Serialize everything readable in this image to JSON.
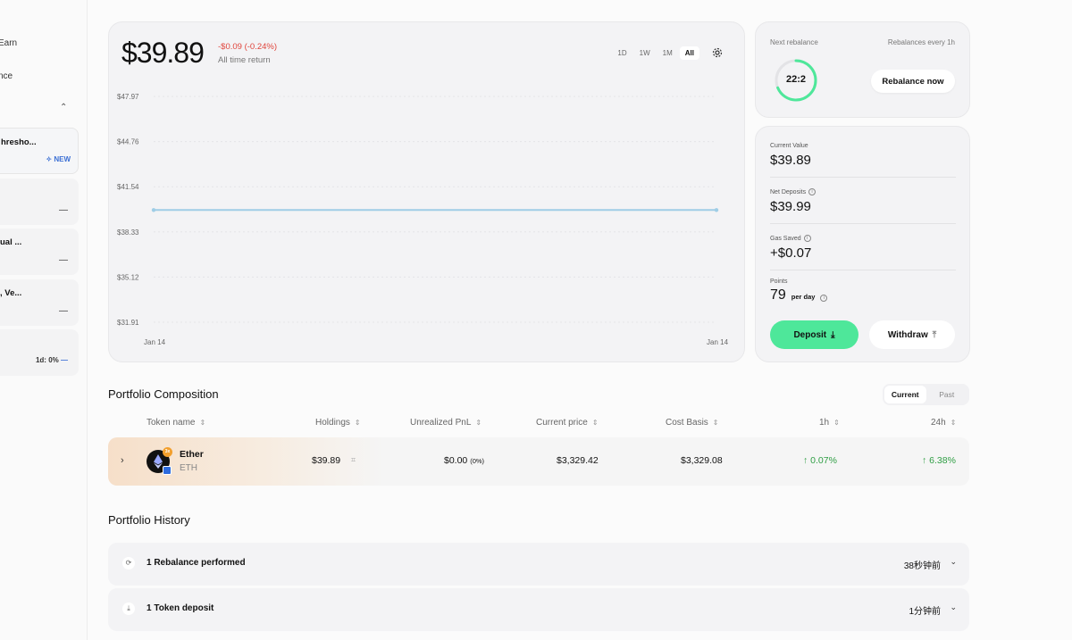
{
  "sidebar": {
    "earn_label": "Earn",
    "nce_label": "nce",
    "cards": [
      {
        "title": "hresho...",
        "badge": "NEW",
        "badge_icon": "sparkle-icon"
      },
      {
        "title": "",
        "value": "—"
      },
      {
        "title": "ual ...",
        "value": "—"
      },
      {
        "title": ", Ve...",
        "value": "—"
      },
      {
        "title": "",
        "value": "1d: 0%",
        "value_dash": "—"
      }
    ]
  },
  "chart": {
    "value": "$39.89",
    "delta": "-$0.09 (-0.24%)",
    "delta_label": "All time return",
    "ranges": [
      "1D",
      "1W",
      "1M",
      "All"
    ],
    "active_range": "All"
  },
  "chart_data": {
    "type": "line",
    "title": "",
    "x": [
      "Jan 14",
      "Jan 14"
    ],
    "y": [
      39.89,
      39.89
    ],
    "yticks": [
      "$47.97",
      "$44.76",
      "$41.54",
      "$38.33",
      "$35.12",
      "$31.91"
    ],
    "xticks": [
      "Jan 14",
      "Jan 14"
    ],
    "ylim": [
      31.91,
      47.97
    ],
    "color": "#9fcde6"
  },
  "rebalance": {
    "next_label": "Next rebalance",
    "every_label": "Rebalances every 1h",
    "timer": "22:2",
    "button": "Rebalance now",
    "progress_color": "#4ee79a"
  },
  "stats": {
    "current_value_label": "Current Value",
    "current_value": "$39.89",
    "net_deposits_label": "Net Deposits",
    "net_deposits": "$39.99",
    "gas_saved_label": "Gas Saved",
    "gas_saved": "+$0.07",
    "points_label": "Points",
    "points": "79",
    "points_unit": "per day",
    "deposit_button": "Deposit",
    "withdraw_button": "Withdraw",
    "deposit_color": "#4ee79a"
  },
  "composition": {
    "title": "Portfolio Composition",
    "toggle": [
      "Current",
      "Past"
    ],
    "active_toggle": "Current",
    "headers": {
      "token": "Token name",
      "holdings": "Holdings",
      "pnl": "Unrealized PnL",
      "price": "Current price",
      "cost": "Cost Basis",
      "h1": "1h",
      "h24": "24h"
    },
    "rows": [
      {
        "name": "Ether",
        "symbol": "ETH",
        "badge": "3x",
        "holdings": "$39.89",
        "pnl": "$0.00",
        "pnl_pct": "(0%)",
        "price": "$3,329.42",
        "cost": "$3,329.08",
        "h1": "0.07%",
        "h24": "6.38%"
      }
    ]
  },
  "history": {
    "title": "Portfolio History",
    "items": [
      {
        "label": "1 Rebalance performed",
        "time": "38秒钟前",
        "icon": "refresh-icon"
      },
      {
        "label": "1 Token deposit",
        "time": "1分钟前",
        "icon": "download-icon"
      }
    ]
  }
}
